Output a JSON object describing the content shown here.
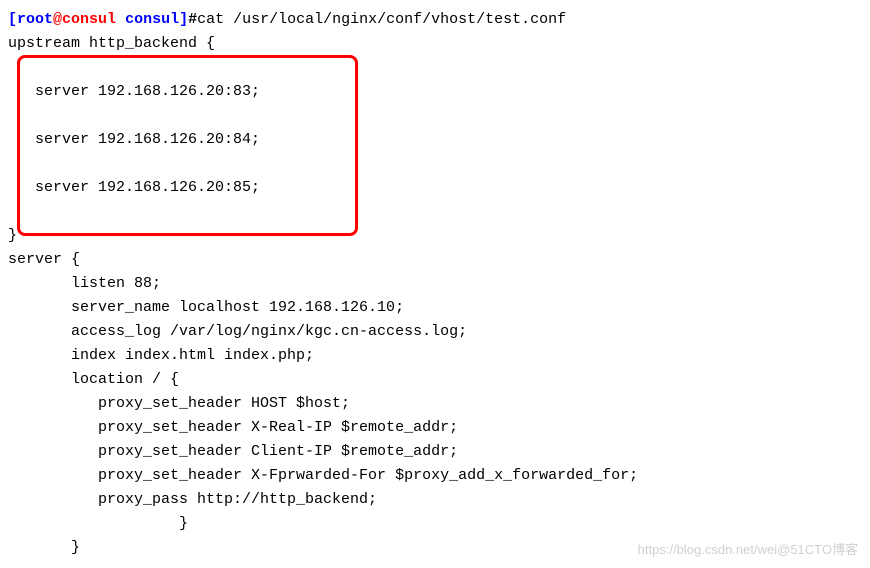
{
  "prompt": {
    "user": "root",
    "host": "consul",
    "cwd": "consul",
    "command": "cat /usr/local/nginx/conf/vhost/test.conf"
  },
  "config": {
    "upstream_open": "upstream http_backend {",
    "blank1": "",
    "srv1": "   server 192.168.126.20:83;",
    "blank2": "",
    "srv2": "   server 192.168.126.20:84;",
    "blank3": "",
    "srv3": "   server 192.168.126.20:85;",
    "blank4": "",
    "upstream_close": "}",
    "server_open": "server {",
    "listen": "       listen 88;",
    "server_name": "       server_name localhost 192.168.126.10;",
    "access_log": "       access_log /var/log/nginx/kgc.cn-access.log;",
    "index": "       index index.html index.php;",
    "location_open": "       location / {",
    "proxy1": "          proxy_set_header HOST $host;",
    "proxy2": "          proxy_set_header X-Real-IP $remote_addr;",
    "proxy3": "          proxy_set_header Client-IP $remote_addr;",
    "proxy4": "          proxy_set_header X-Fprwarded-For $proxy_add_x_forwarded_for;",
    "proxy5": "          proxy_pass http://http_backend;",
    "location_close": "                   }",
    "server_close": "       }"
  },
  "watermark": "https://blog.csdn.net/wei@51CTO博客"
}
